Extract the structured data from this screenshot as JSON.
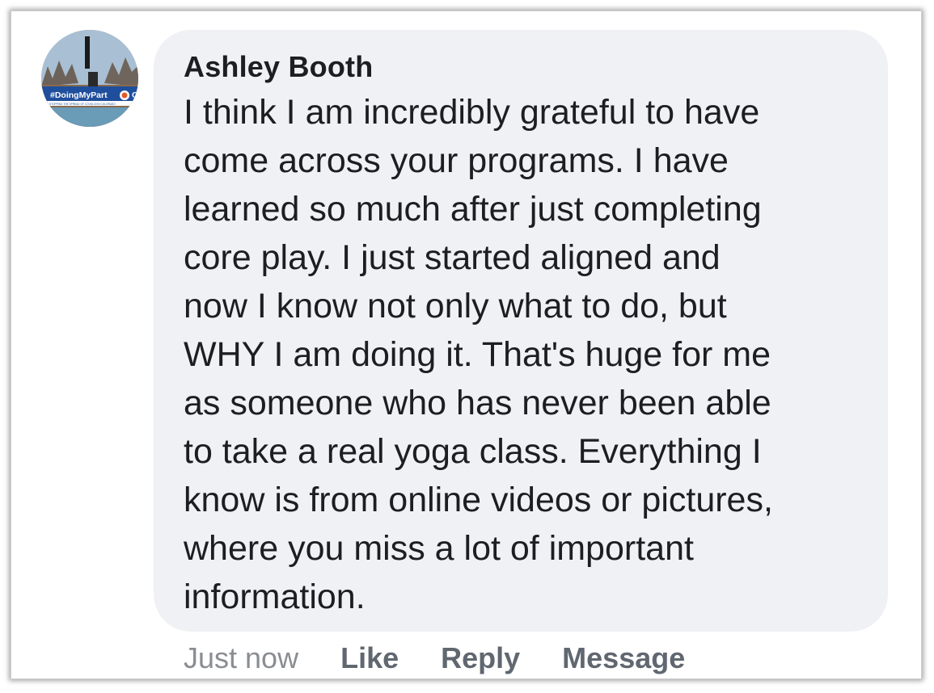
{
  "comment": {
    "author": "Ashley Booth",
    "avatar": {
      "badge_text": "#DoingMyPart",
      "badge_subtext": "STOPPING THE SPREAD OF COVID-19 IN COLORADO",
      "badge_color": "#1f4e9c"
    },
    "text_lines": [
      "I think I am incredibly grateful to have",
      "come across your programs. I have",
      "learned so much after just completing",
      "core play. I just started aligned and",
      "now I know not only what to do, but",
      "WHY I am doing it. That's huge for me",
      "as someone who has never been able",
      "to take a real yoga class. Everything I",
      "know is from online videos or pictures,",
      "where you miss a lot of important",
      "information."
    ],
    "timestamp": "Just now",
    "actions": {
      "like": "Like",
      "reply": "Reply",
      "message": "Message"
    }
  },
  "colors": {
    "bubble_bg": "#f0f1f5",
    "text": "#1c1e21",
    "timestamp": "#8a8d91",
    "action": "#606770"
  }
}
